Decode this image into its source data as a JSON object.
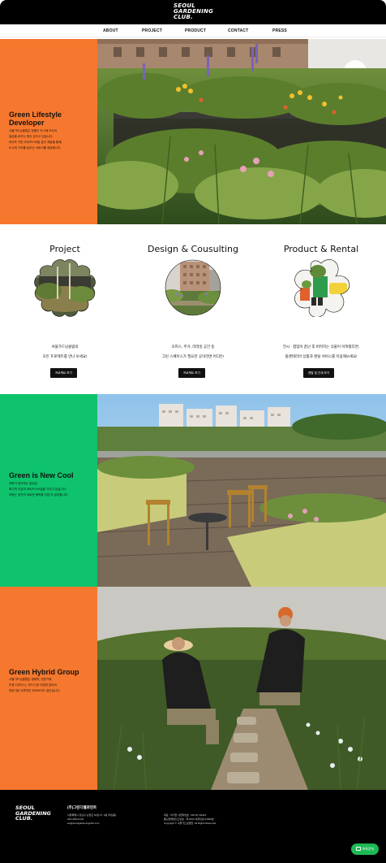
{
  "header": {
    "logo_lines": [
      "SEOUL",
      "GARDENING",
      "CLUB."
    ]
  },
  "nav": {
    "items": [
      {
        "label": "ABOUT"
      },
      {
        "label": "PROJECT"
      },
      {
        "label": "PRODUCT"
      },
      {
        "label": "CONTACT"
      },
      {
        "label": "PRESS"
      }
    ]
  },
  "hero": {
    "title_lines": [
      "Green Lifestyle",
      "Developer"
    ],
    "body_lines": [
      "서울가드닝클럽은 정원이 도시에 보두의",
      "일상을 바꾸는 힘이 있다고 믿습니다.",
      "라이프 가든 라이프스타일 공간 개발을 통해,",
      "도시의 가치를 높이는 서비스를 제공합니다."
    ]
  },
  "cards": [
    {
      "title": "Project",
      "text_lines": [
        "서울가드닝클럽의",
        "모든 프로젝트를 만나 보세요!"
      ],
      "button": "프로젝트 보기"
    },
    {
      "title": "Design & Cousulting",
      "text_lines": [
        "오피스, 주거, 리테일 공간 등",
        "그린 스페이스가 필요한 곳이라면 어디든!"
      ],
      "button": "프로젝트 보기"
    },
    {
      "title": "Product & Rental",
      "text_lines": [
        "전시 · 팝업이 끝난 후 버려지는 식물이 아까웠다면,",
        "플랜테리어 상품과 렌탈 서비스를 이용해보세요!"
      ],
      "button": "렌탈 및 관계 보기"
    }
  ],
  "section_cool": {
    "title": "Green is New Cool",
    "body_lines": [
      "저희가 생각하는 일상은",
      "획기적 지금의 라이프스타일을 가지고 있습니다.",
      "저희는 공간의 새로운 매력을 더한 뒤 공유합니다."
    ]
  },
  "section_hybrid": {
    "title": "Green Hybrid Group",
    "body_lines": [
      "서울가드닝클럽은 생태학, 전문가와,",
      "조경 디자이너, 가드너 등 다양한 분야의",
      "전문가로 이루어진 하이브리드 집단입니다."
    ]
  },
  "footer": {
    "logo_lines": [
      "SEOUL",
      "GARDENING",
      "CLUB."
    ],
    "company": "(주)그린디벨로먼트",
    "info_lines": [
      "서울특별시 강남구 논현로 54길 37, 2층 (역삼동)",
      "010-4360-4191",
      "we@seoulgardeningclub.com"
    ],
    "info2_lines": [
      "대표 : 이기현   사업자번호 : 397-87-02224",
      "통신판매업신고번호 : 제 2023-서울강남-01906호",
      "Copyright © 서울가드닝클럽. All Rights Reserved."
    ]
  },
  "chat_button": "톡톡문의",
  "colors": {
    "orange": "#f6782e",
    "green": "#0ec36b",
    "black": "#000000"
  }
}
